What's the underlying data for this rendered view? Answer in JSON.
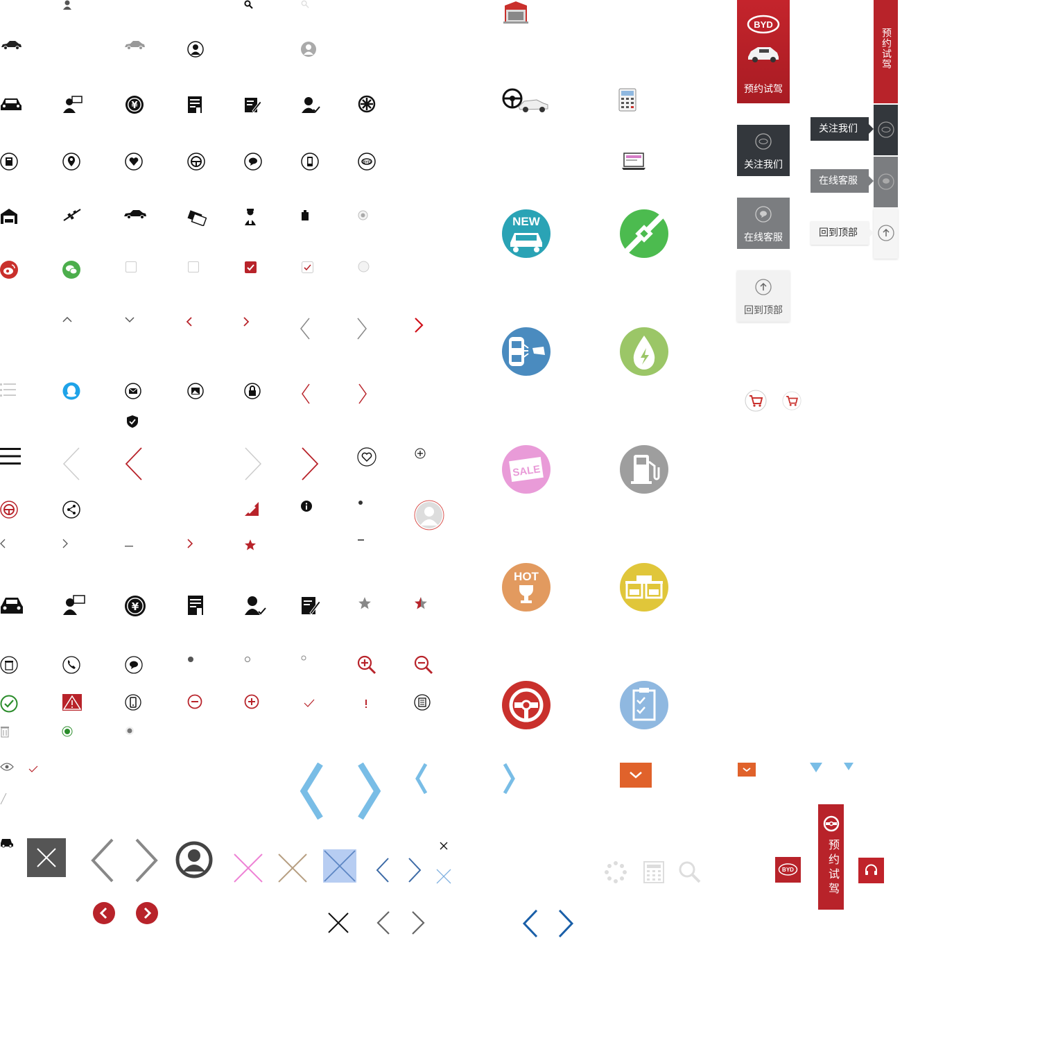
{
  "colors": {
    "brand_red": "#b8232a",
    "dark_panel": "#33373c",
    "gray_panel": "#7b7d80",
    "light_panel": "#f2f2f2",
    "teal": "#2aa3b5",
    "green": "#4cbb4f",
    "steel_blue": "#4a8bbf",
    "lime": "#9bc667",
    "pink": "#e99bd8",
    "gray": "#9e9e9e",
    "orange": "#e29a5f",
    "yellow": "#e0c63a",
    "light_blue": "#8fb8e0",
    "sky": "#79bde6",
    "orange_box": "#e0622b"
  },
  "badges": {
    "new_label": "NEW",
    "sale_label": "SALE",
    "hot_label": "HOT"
  },
  "sidebar_large": {
    "logo_text": "BYD",
    "test_drive_label": "预约试驾",
    "follow_label": "关注我们",
    "service_label": "在线客服",
    "top_label": "回到顶部"
  },
  "sidebar_compact": {
    "test_drive_label": "预约试驾",
    "follow_label": "关注我们",
    "service_label": "在线客服",
    "top_label": "回到顶部"
  },
  "bottom_bar": {
    "logo_text": "BYD",
    "test_drive_label": "预约试驾"
  },
  "icons": [
    "user-icon",
    "search-icon",
    "car-icon",
    "avatar-icon",
    "consultant-icon",
    "yuan-icon",
    "receipt-icon",
    "edit-icon",
    "user-check-icon",
    "wheel-icon",
    "calculator-icon",
    "location-icon",
    "heart-icon",
    "steering-wheel-icon",
    "chat-icon",
    "mobile-icon",
    "garage-icon",
    "racing-flag-icon",
    "card-icon",
    "mechanic-icon",
    "clipboard-icon",
    "radio-icon",
    "weibo-icon",
    "wechat-icon",
    "checkbox-icon",
    "chevron-up-icon",
    "chevron-down-icon",
    "chevron-left-icon",
    "chevron-right-icon",
    "list-icon",
    "qq-icon",
    "mail-icon",
    "image-icon",
    "lock-icon",
    "shield-icon",
    "menu-icon",
    "plus-icon",
    "share-icon",
    "info-icon",
    "star-icon",
    "trash-icon",
    "phone-icon",
    "zoom-in-icon",
    "zoom-out-icon",
    "check-circle-icon",
    "warning-icon",
    "minus-circle-icon",
    "plus-circle-icon",
    "document-icon",
    "eye-icon",
    "close-icon",
    "cart-icon",
    "loading-icon",
    "headset-icon"
  ]
}
